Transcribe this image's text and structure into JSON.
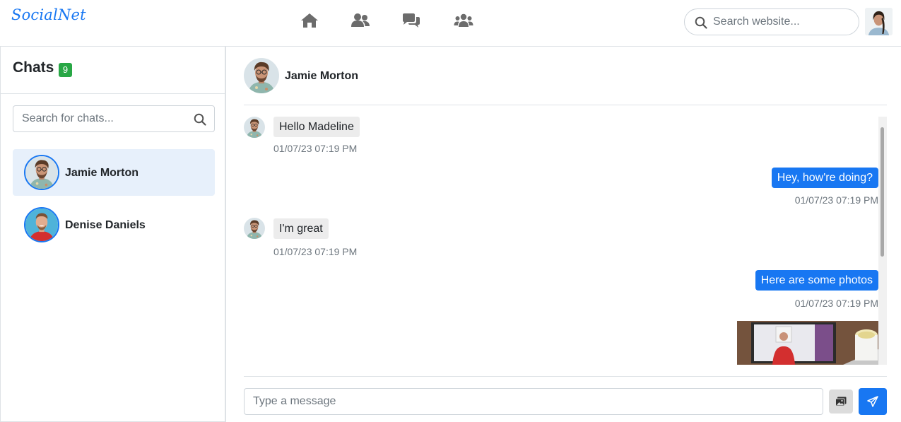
{
  "brand": {
    "logo_text": "SocialNet",
    "accent": "#1877f2"
  },
  "nav": {
    "icons": [
      "home-icon",
      "friends-icon",
      "chat-icon",
      "groups-icon"
    ],
    "search_placeholder": "Search website..."
  },
  "sidebar": {
    "title": "Chats",
    "badge": "9",
    "search_placeholder": "Search for chats...",
    "chats": [
      {
        "name": "Jamie Morton",
        "active": true
      },
      {
        "name": "Denise Daniels",
        "active": false
      }
    ]
  },
  "conversation": {
    "contact_name": "Jamie Morton",
    "messages": [
      {
        "direction": "in",
        "text": "Hello Madeline",
        "time": "01/07/23 07:19 PM"
      },
      {
        "direction": "out",
        "text": "Hey, how're doing?",
        "time": "01/07/23 07:19 PM"
      },
      {
        "direction": "in",
        "text": "I'm great",
        "time": "01/07/23 07:19 PM"
      },
      {
        "direction": "out",
        "text": "Here are some photos",
        "time": "01/07/23 07:19 PM"
      }
    ]
  },
  "composer": {
    "placeholder": "Type a message"
  }
}
